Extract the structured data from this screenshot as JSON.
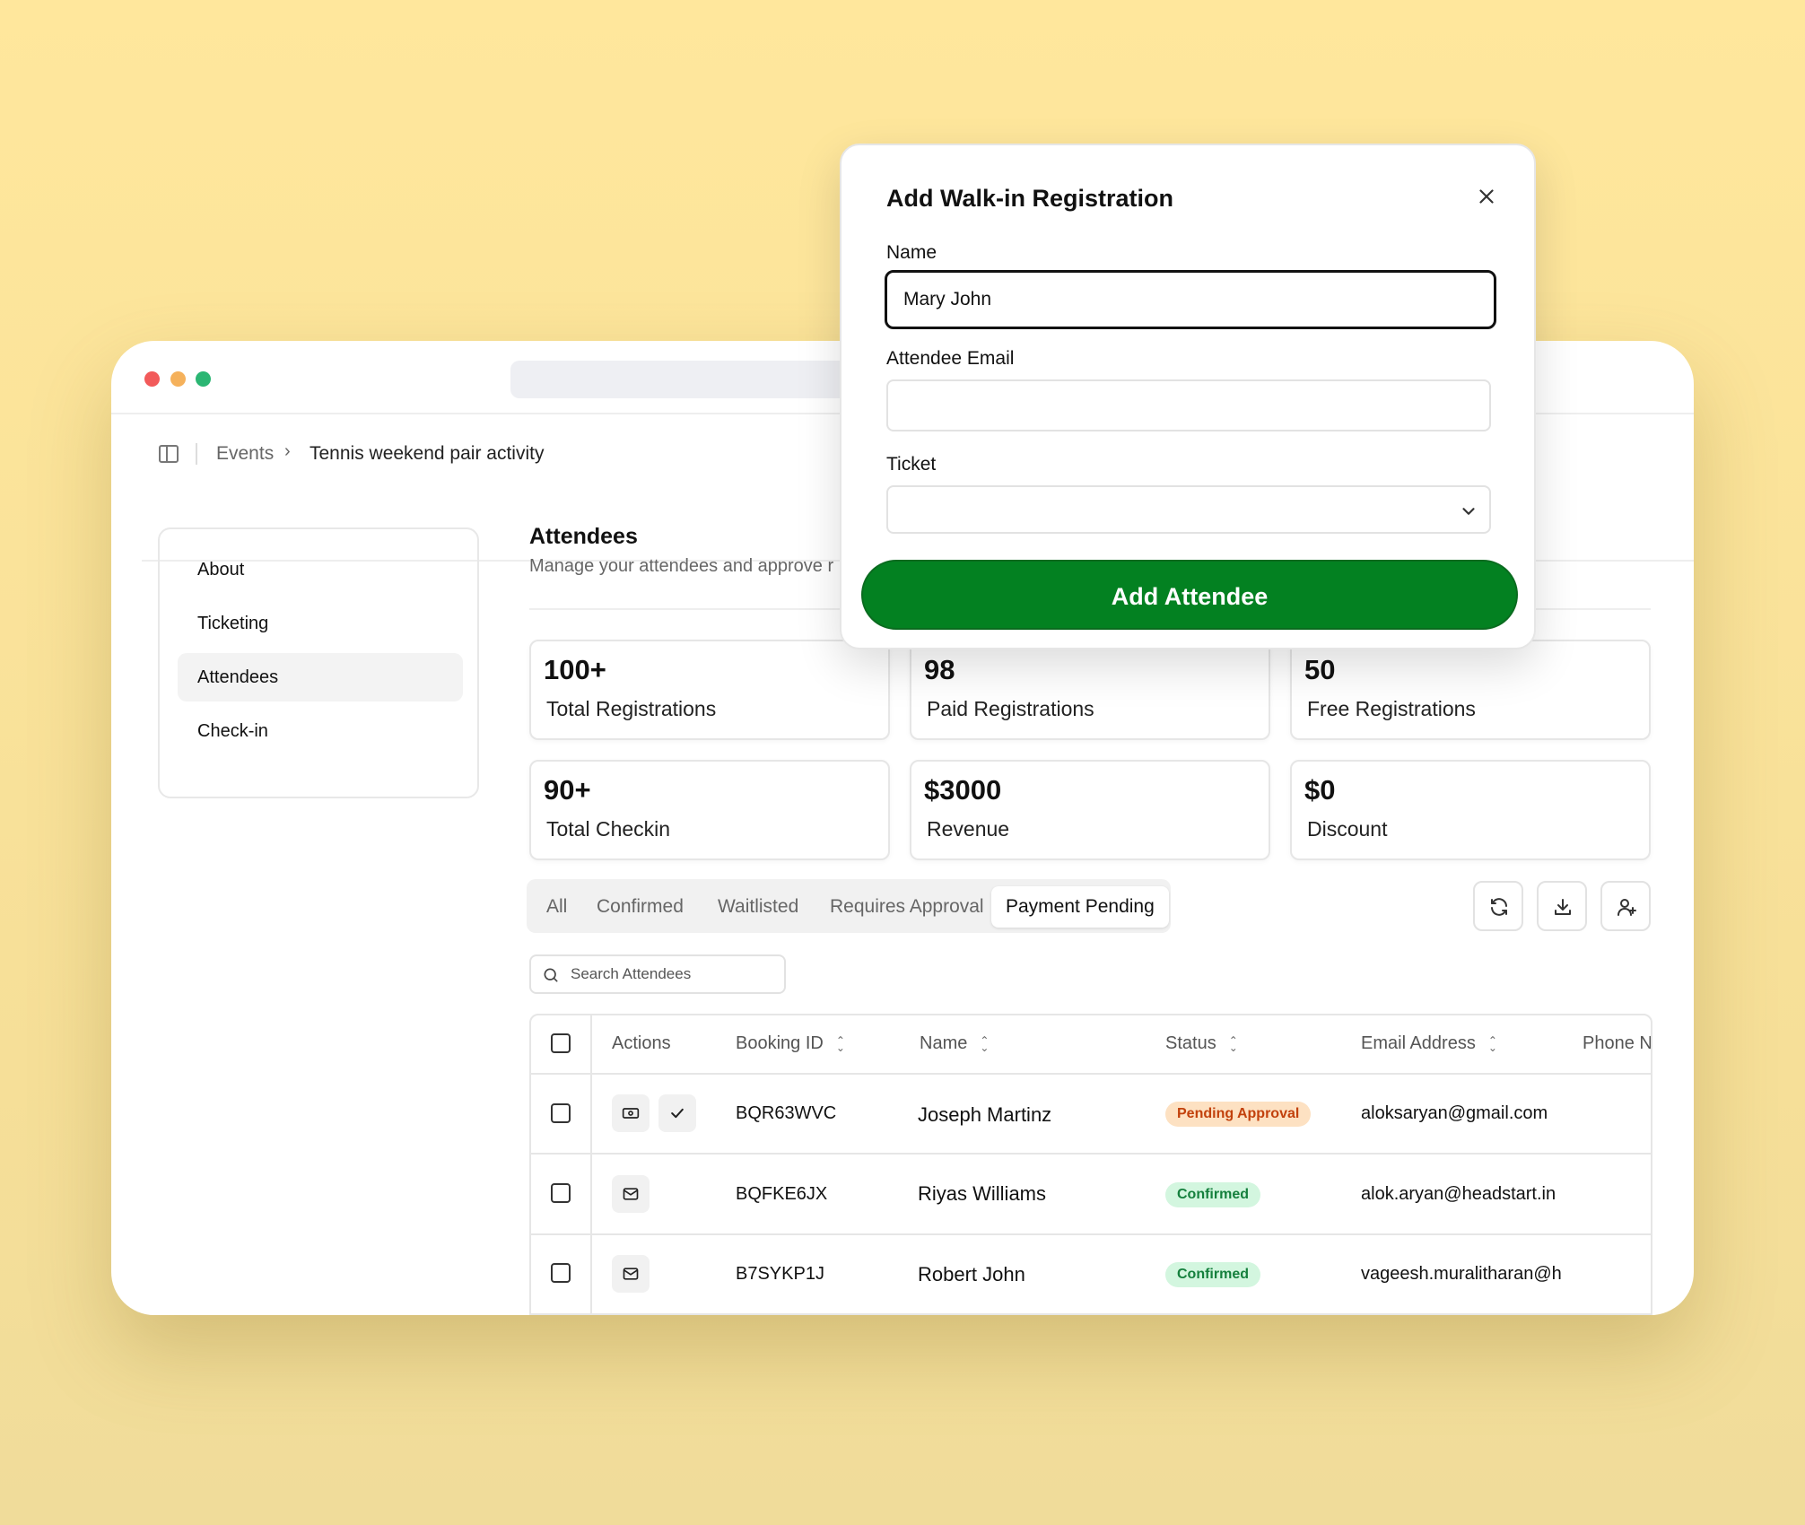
{
  "breadcrumb": {
    "parent": "Events",
    "separator": "›",
    "current": "Tennis weekend pair activity"
  },
  "sidebar": {
    "items": [
      {
        "label": "About"
      },
      {
        "label": "Ticketing"
      },
      {
        "label": "Attendees",
        "active": true
      },
      {
        "label": "Check-in"
      }
    ]
  },
  "main": {
    "title": "Attendees",
    "subtitle": "Manage your attendees and approve r"
  },
  "stats": [
    {
      "value": "100+",
      "label": "Total Registrations"
    },
    {
      "value": "98",
      "label": "Paid Registrations"
    },
    {
      "value": "50",
      "label": "Free Registrations"
    },
    {
      "value": "90+",
      "label": "Total Checkin"
    },
    {
      "value": "$3000",
      "label": "Revenue"
    },
    {
      "value": "$0",
      "label": "Discount"
    }
  ],
  "tabs": [
    {
      "label": "All"
    },
    {
      "label": "Confirmed"
    },
    {
      "label": "Waitlisted"
    },
    {
      "label": "Requires Approval"
    },
    {
      "label": "Payment Pending",
      "active": true
    }
  ],
  "toolbar": {
    "icons": [
      "refresh-icon",
      "download-icon",
      "add-user-icon"
    ]
  },
  "search": {
    "placeholder": "Search Attendees"
  },
  "table": {
    "columns": [
      "Actions",
      "Booking ID",
      "Name",
      "Status",
      "Email Address",
      "Phone N"
    ],
    "rows": [
      {
        "booking_id": "BQR63WVC",
        "name": "Joseph Martinz",
        "status": "Pending Approval",
        "email": "aloksaryan@gmail.com"
      },
      {
        "booking_id": "BQFKE6JX",
        "name": "Riyas Williams",
        "status": "Confirmed",
        "email": "alok.aryan@headstart.in"
      },
      {
        "booking_id": "B7SYKP1J",
        "name": "Robert John",
        "status": "Confirmed",
        "email": "vageesh.muralitharan@h"
      }
    ]
  },
  "modal": {
    "title": "Add Walk-in Registration",
    "name_label": "Name",
    "name_value": "Mary John",
    "email_label": "Attendee Email",
    "email_value": "",
    "ticket_label": "Ticket",
    "submit_label": "Add Attendee"
  },
  "colors": {
    "background": "#ffe79c",
    "primary_button": "#038121",
    "pending_badge": "#fde1c2",
    "confirmed_badge": "#d3f6df"
  }
}
